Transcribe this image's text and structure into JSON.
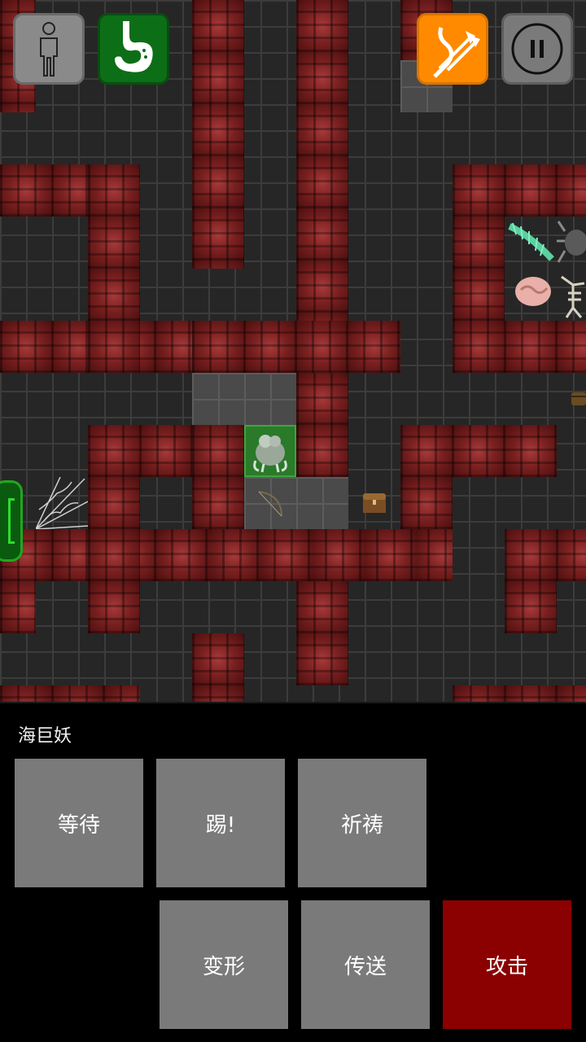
{
  "hud": {
    "character_icon": "person-outline-icon",
    "stomach_icon": "stomach-icon",
    "quiver_icon": "quiver-arrows-icon",
    "pause_icon": "pause-icon",
    "colors": {
      "character_bg": "#8a8a8a",
      "stomach_bg": "#0d6e18",
      "quiver_bg": "#ff8a00",
      "pause_bg": "#7a7a7a"
    }
  },
  "map": {
    "sprites": [
      "player-monster-icon",
      "centipede-icon",
      "spider-icon",
      "brain-blob-icon",
      "unicorn-skeleton-icon",
      "chest-icon",
      "cobweb-icon",
      "bow-icon",
      "barrel-icon"
    ],
    "colors": {
      "wall": "#6e1a1a",
      "floor": "#262626",
      "player_highlight": "#2a7a2a"
    }
  },
  "panel": {
    "monster_name": "海巨妖",
    "actions": {
      "wait": "等待",
      "kick": "踢!",
      "pray": "祈祷",
      "polymorph": "变形",
      "teleport": "传送",
      "attack": "攻击"
    },
    "colors": {
      "button": "#7a7a7a",
      "attack": "#8b0000"
    }
  }
}
